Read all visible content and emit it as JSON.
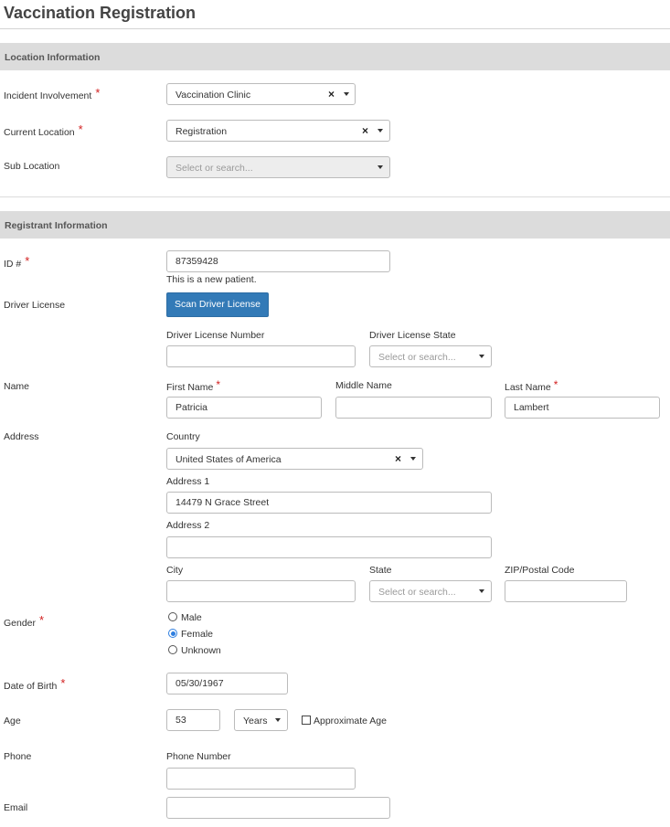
{
  "page_title": "Vaccination Registration",
  "sections": {
    "location": "Location Information",
    "registrant": "Registrant Information"
  },
  "location": {
    "incident_involvement": {
      "label": "Incident Involvement",
      "value": "Vaccination Clinic"
    },
    "current_location": {
      "label": "Current Location",
      "value": "Registration"
    },
    "sub_location": {
      "label": "Sub Location",
      "placeholder": "Select or search..."
    }
  },
  "registrant": {
    "id": {
      "label": "ID #",
      "value": "87359428",
      "hint": "This is a new patient."
    },
    "driver_license": {
      "label": "Driver License",
      "scan_button": "Scan Driver License",
      "number_label": "Driver License Number",
      "number_value": "",
      "state_label": "Driver License State",
      "state_placeholder": "Select or search..."
    },
    "name": {
      "label": "Name",
      "first_label": "First Name",
      "first_value": "Patricia",
      "middle_label": "Middle Name",
      "middle_value": "",
      "last_label": "Last Name",
      "last_value": "Lambert"
    },
    "address": {
      "label": "Address",
      "country_label": "Country",
      "country_value": "United States of America",
      "address1_label": "Address 1",
      "address1_value": "14479 N Grace Street",
      "address2_label": "Address 2",
      "address2_value": "",
      "city_label": "City",
      "city_value": "",
      "state_label": "State",
      "state_placeholder": "Select or search...",
      "zip_label": "ZIP/Postal Code",
      "zip_value": ""
    },
    "gender": {
      "label": "Gender",
      "options": [
        "Male",
        "Female",
        "Unknown"
      ],
      "selected": "Female"
    },
    "dob": {
      "label": "Date of Birth",
      "value": "05/30/1967"
    },
    "age": {
      "label": "Age",
      "value": "53",
      "unit": "Years",
      "approx_label": "Approximate Age"
    },
    "phone": {
      "label": "Phone",
      "number_label": "Phone Number",
      "number_value": ""
    },
    "email": {
      "label": "Email",
      "value": ""
    }
  },
  "icons": {
    "clear": "×",
    "dropdown": "caret-down-icon"
  }
}
